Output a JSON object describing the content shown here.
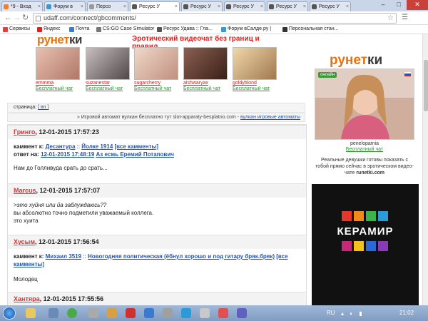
{
  "tabs": [
    {
      "label": "*9 - Вход"
    },
    {
      "label": "Форум в"
    },
    {
      "label": "Персо"
    },
    {
      "label": "Ресурс У"
    },
    {
      "label": "Ресурс У"
    },
    {
      "label": "Ресурс У"
    },
    {
      "label": "Ресурс У"
    },
    {
      "label": "Ресурс У"
    }
  ],
  "address": {
    "url": "udaff.com/connect/gbcomments/"
  },
  "bookmarks": [
    {
      "label": "Сервисы",
      "color": "#e04040"
    },
    {
      "label": "Яндекс",
      "color": "#e02020"
    },
    {
      "label": "Почта",
      "color": "#3a7ad0"
    },
    {
      "label": "CS:GO Case Simulator",
      "color": "#777777"
    },
    {
      "label": "Ресурс Удава :: Гла...",
      "color": "#555555"
    },
    {
      "label": "Форум вСалде.ру |",
      "color": "#3a9ad0"
    },
    {
      "label": "Персональная стан...",
      "color": "#333333"
    }
  ],
  "banner": {
    "brand_main": "рунет",
    "brand_suffix": "ки",
    "title": "Эротический видеочат без границ и правил",
    "models": [
      {
        "name": "emmma",
        "status": "Бесплатный чат",
        "color": "#c99a86"
      },
      {
        "name": "suzanestar",
        "status": "Бесплатный чат",
        "color": "#9a8a8a"
      },
      {
        "name": "sugarcherry",
        "status": "Бесплатный чат",
        "color": "#e0b8a8"
      },
      {
        "name": "aishwaryax",
        "status": "Бесплатный чат",
        "color": "#6a4a3a"
      },
      {
        "name": "goldyblond",
        "status": "Бесплатный чат",
        "color": "#d8b890"
      }
    ]
  },
  "pager": {
    "label": "страница:",
    "link": "[ вп ]"
  },
  "adline": {
    "text": "» Игровой автомат вулкан бесплатно тут slot-apparaty-besplatno.com - ",
    "link": "вулкан игровые автоматы"
  },
  "comments": [
    {
      "author": "Гринго",
      "date": ", 12-01-2015 17:57:23",
      "label1": "каммент к:",
      "link1a": "Десантура",
      "sep1": " :: ",
      "link1b": "Йолке 1914",
      "link1c": "[все камменты]",
      "label2": "ответ на:",
      "link2a": "12-01-2015 17:48:19",
      "link2b": "Аз есмь Еремий Потапович",
      "text": "Нам до Голливуда срать до срать..."
    },
    {
      "author": "Marcus",
      "date": ", 12-01-2015 17:57:07",
      "quote1": ">это хуйня или йа заблуждаюсь??",
      "line2": "вы абсолютно точно подметили уважаемый коллега.",
      "line3": "это хуита"
    },
    {
      "author": "Хусым",
      "date": ", 12-01-2015 17:56:54",
      "label1": "каммент к:",
      "link1a": "Михаил 3519",
      "sep1": " :: ",
      "link1b": "Новогодняя политическая (ёбнул хорошо и под гитару бряк.бряк)",
      "link1c": "[все камменты]",
      "text": "Молодец"
    },
    {
      "author": "Хантяра",
      "date": ", 12-01-2015 17:55:56"
    }
  ],
  "sidebar": {
    "brand_main": "рунет",
    "brand_suffix": "ки",
    "online": "онлайн",
    "model_name": "penelopamia",
    "model_status": "Бесплатный чат",
    "promo_pre": "Реальные девушки готовы показать с тобой прямо сейчас в эротическом видео-чате ",
    "promo_site": "runetki.com",
    "keramir_word": "КЕРАМИР"
  },
  "taskbar": {
    "lang": "RU",
    "time": "21:02"
  }
}
